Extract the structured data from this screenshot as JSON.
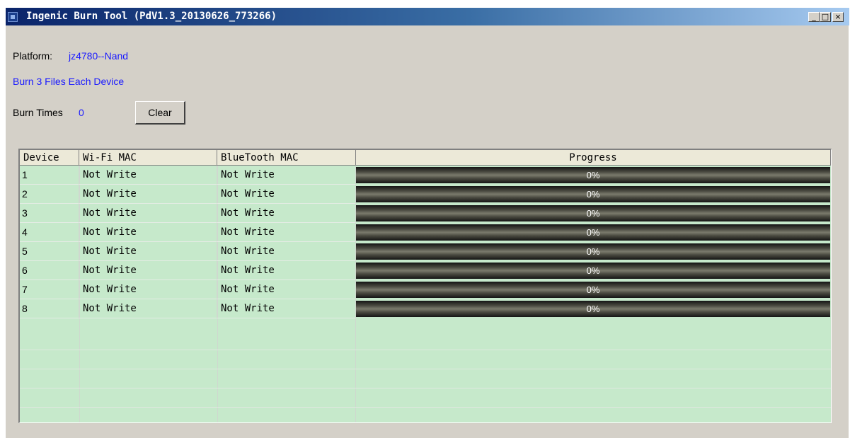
{
  "window": {
    "title": "Ingenic Burn Tool (PdV1.3_20130626_773266)",
    "controls": {
      "minimize": "_",
      "maximize": "□",
      "close": "×"
    }
  },
  "platform": {
    "label": "Platform:",
    "value": "jz4780--Nand"
  },
  "burn_info": "Burn 3 Files Each Device",
  "burn_times": {
    "label": "Burn Times",
    "value": "0"
  },
  "clear_button": "Clear",
  "table": {
    "columns": [
      "Device",
      "Wi-Fi MAC",
      "BlueTooth MAC",
      "Progress"
    ],
    "rows": [
      {
        "device": "1",
        "wifi_mac": "Not Write",
        "bt_mac": "Not Write",
        "progress_text": "0%",
        "progress": 0
      },
      {
        "device": "2",
        "wifi_mac": "Not Write",
        "bt_mac": "Not Write",
        "progress_text": "0%",
        "progress": 0
      },
      {
        "device": "3",
        "wifi_mac": "Not Write",
        "bt_mac": "Not Write",
        "progress_text": "0%",
        "progress": 0
      },
      {
        "device": "4",
        "wifi_mac": "Not Write",
        "bt_mac": "Not Write",
        "progress_text": "0%",
        "progress": 0
      },
      {
        "device": "5",
        "wifi_mac": "Not Write",
        "bt_mac": "Not Write",
        "progress_text": "0%",
        "progress": 0
      },
      {
        "device": "6",
        "wifi_mac": "Not Write",
        "bt_mac": "Not Write",
        "progress_text": "0%",
        "progress": 0
      },
      {
        "device": "7",
        "wifi_mac": "Not Write",
        "bt_mac": "Not Write",
        "progress_text": "0%",
        "progress": 0
      },
      {
        "device": "8",
        "wifi_mac": "Not Write",
        "bt_mac": "Not Write",
        "progress_text": "0%",
        "progress": 0
      }
    ]
  },
  "colors": {
    "title_gradient_start": "#0a246a",
    "title_gradient_end": "#a6caf0",
    "link_blue": "#1a1aff",
    "grid_background": "#c6e9cb",
    "window_face": "#d4d0c8"
  },
  "icons": {
    "app": "app-icon",
    "minimize": "minimize-icon",
    "maximize": "maximize-icon",
    "close": "close-icon"
  }
}
